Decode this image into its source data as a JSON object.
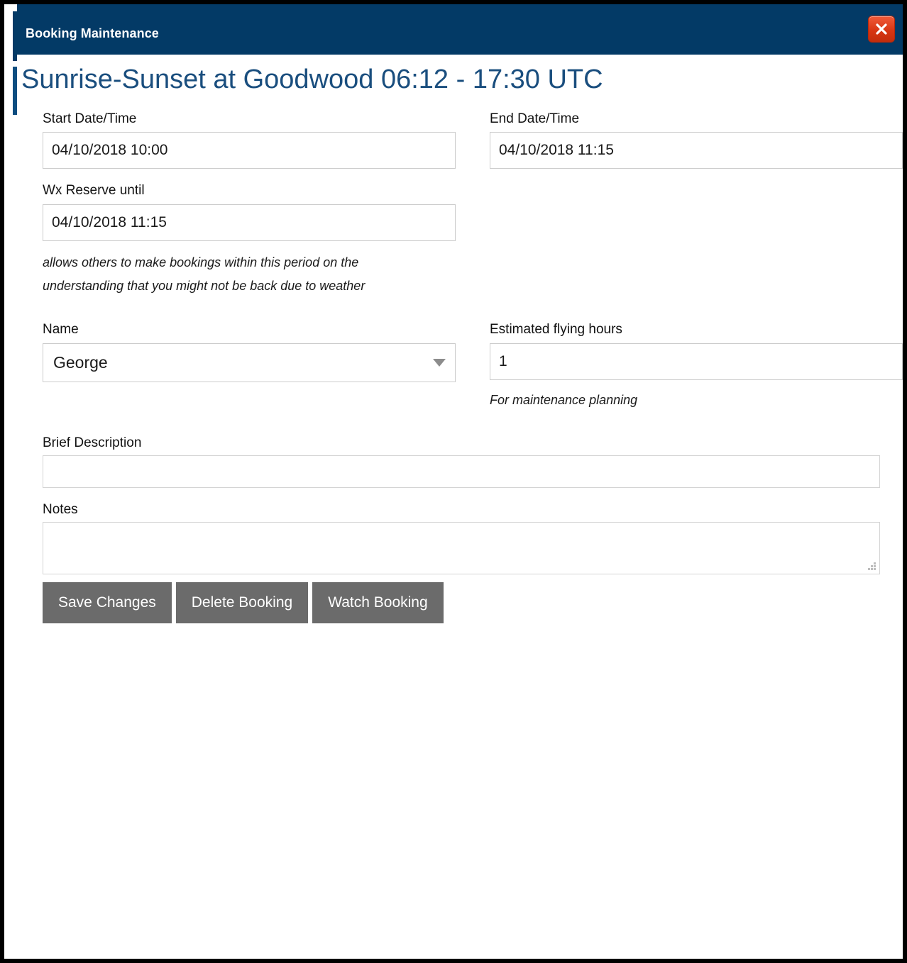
{
  "window": {
    "title": "Booking Maintenance",
    "close_icon": "close-icon",
    "titlebar_color": "#033A66",
    "heading": "Sunrise-Sunset at Goodwood 06:12 - 17:30 UTC",
    "heading_color": "#1A4E7E"
  },
  "form": {
    "start_datetime": {
      "label": "Start Date/Time",
      "value": "04/10/2018 10:00",
      "placeholder": ""
    },
    "end_datetime": {
      "label": "End Date/Time",
      "value": "04/10/2018 11:15",
      "placeholder": ""
    },
    "wx_reserve": {
      "label": "Wx Reserve until",
      "value": "04/10/2018 11:15",
      "placeholder": "",
      "hint_line1": "allows others to make bookings within this period on the",
      "hint_line2": "understanding that you might not be back due to weather"
    },
    "name": {
      "label": "Name",
      "value": "George",
      "dropdown_icon": "chevron-down-icon"
    },
    "estimated_hours": {
      "label": "Estimated flying hours",
      "value": "1",
      "placeholder": "",
      "hint": "For maintenance planning"
    },
    "brief_description": {
      "label": "Brief Description",
      "value": "",
      "placeholder": ""
    },
    "notes": {
      "label": "Notes",
      "value": "",
      "placeholder": "",
      "resize_icon": "resize-grip-icon"
    }
  },
  "buttons": {
    "color": "#6B6B6B",
    "save": "Save Changes",
    "delete": "Delete Booking",
    "watch": "Watch Booking"
  }
}
